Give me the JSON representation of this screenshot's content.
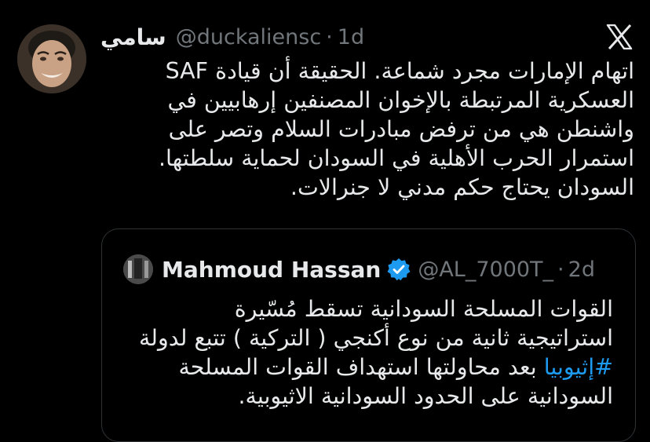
{
  "tweet": {
    "author_name": "سامي",
    "handle": "@duckaliensc",
    "separator": "·",
    "time": "1d",
    "text": "اتهام الإمارات مجرد شماعة. الحقيقة أن قيادة SAF\nالعسكرية المرتبطة بالإخوان المصنفين إرهابيين في\nواشنطن هي من ترفض مبادرات السلام وتصر على\nاستمرار الحرب الأهلية في السودان لحماية سلطتها.\nالسودان يحتاج حكم مدني لا جنرالات."
  },
  "quoted_tweet": {
    "author_name": "Mahmoud Hassan",
    "handle": "@AL_7000T_",
    "separator": "·",
    "time": "2d",
    "lines": [
      "القوات المسلحة السودانية تسقط مُسّيرة",
      "استراتيجية ثانية من نوع أكنجي ( التركية ) تتبع لدولة"
    ],
    "hashtag": "#إثيوبيا",
    "hashtag_line_rest": " بعد محاولتها استهداف القوات المسلحة",
    "last_line": "السودانية على الحدود السودانية الاثيوبية."
  },
  "icons": {
    "close": "x-logo-icon",
    "verified": "verified-badge-icon"
  },
  "colors": {
    "background": "#000000",
    "text": "#e7e9ea",
    "secondary": "#71767b",
    "accent": "#1d9bf0",
    "border": "#2f3336"
  }
}
